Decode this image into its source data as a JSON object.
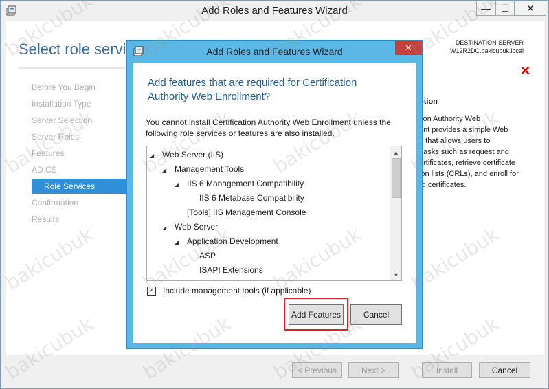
{
  "outer": {
    "title": "Add Roles and Features Wizard",
    "heading": "Select role servi",
    "destination_label": "DESTINATION SERVER",
    "destination_value": "W12R2DC.bakicubuk.local",
    "steps": [
      {
        "label": "Before You Begin",
        "active": false
      },
      {
        "label": "Installation Type",
        "active": false
      },
      {
        "label": "Server Selection",
        "active": false
      },
      {
        "label": "Server Roles",
        "active": false
      },
      {
        "label": "Features",
        "active": false
      },
      {
        "label": "AD CS",
        "active": false
      },
      {
        "label": "Role Services",
        "active": true
      },
      {
        "label": "Confirmation",
        "active": false
      },
      {
        "label": "Results",
        "active": false
      }
    ],
    "description_head": "ption",
    "description": "tion Authority Web\nent provides a simple Web\ne that allows users to\n tasks such as request and\nertificates, retrieve certificate\nion lists (CRLs), and enroll for\nrd certificates.",
    "footer": {
      "previous": "< Previous",
      "next": "Next >",
      "install": "Install",
      "cancel": "Cancel"
    }
  },
  "modal": {
    "title": "Add Roles and Features Wizard",
    "heading": "Add features that are required for Certification Authority Web Enrollment?",
    "message": "You cannot install Certification Authority Web Enrollment unless the following role services or features are also installed.",
    "tree": [
      {
        "label": "Web Server (IIS)",
        "level": 0,
        "expanded": true
      },
      {
        "label": "Management Tools",
        "level": 1,
        "expanded": true
      },
      {
        "label": "IIS 6 Management Compatibility",
        "level": 2,
        "expanded": true
      },
      {
        "label": "IIS 6 Metabase Compatibility",
        "level": 3,
        "expanded": false
      },
      {
        "label": "[Tools] IIS Management Console",
        "level": 2,
        "expanded": false
      },
      {
        "label": "Web Server",
        "level": 1,
        "expanded": true
      },
      {
        "label": "Application Development",
        "level": 2,
        "expanded": true
      },
      {
        "label": "ASP",
        "level": 3,
        "expanded": false
      },
      {
        "label": "ISAPI Extensions",
        "level": 3,
        "expanded": false
      }
    ],
    "include_tools_label": "Include management tools (if applicable)",
    "include_tools_checked": true,
    "add_features_label": "Add Features",
    "cancel_label": "Cancel"
  },
  "colors": {
    "accent": "#2f8fd8",
    "modal_frame": "#5bb7e5",
    "heading_blue": "#1f5c99",
    "highlight_red": "#e02020"
  },
  "watermark": "bakicubuk"
}
